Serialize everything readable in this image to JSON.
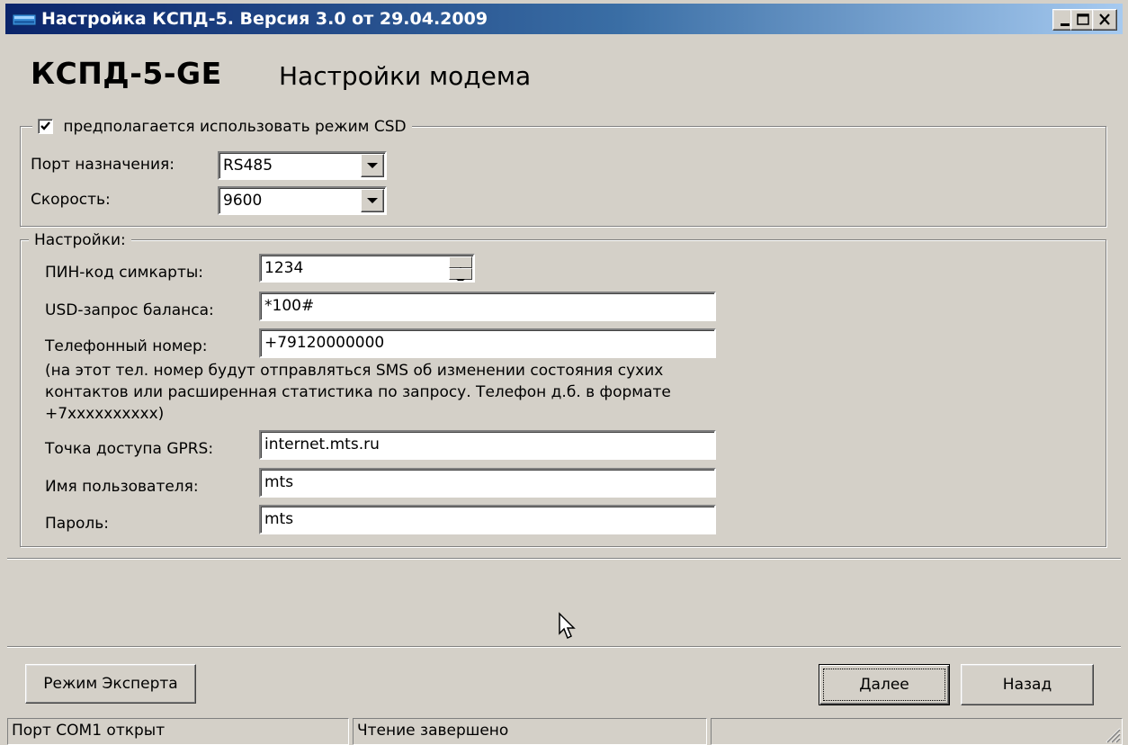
{
  "window": {
    "title": "Настройка КСПД-5. Версия 3.0 от 29.04.2009",
    "controls": {
      "minimize_icon": "minimize-icon",
      "maximize_icon": "maximize-icon",
      "close_icon": "close-icon"
    }
  },
  "header": {
    "brand": "КСПД-5-GE",
    "subtitle": "Настройки модема"
  },
  "csd_group": {
    "checkbox_label": "предполагается использовать режим CSD",
    "checked": true,
    "port_label": "Порт назначения:",
    "port_value": "RS485",
    "speed_label": "Скорость:",
    "speed_value": "9600"
  },
  "settings_group": {
    "legend": "Настройки:",
    "pin_label": "ПИН-код симкарты:",
    "pin_value": "1234",
    "usd_label": "USD-запрос баланса:",
    "usd_value": "*100#",
    "phone_label": "Телефонный номер:",
    "phone_value": "+79120000000",
    "phone_note": "(на этот тел. номер будут отправляться SMS об изменении состояния сухих контактов или расширенная статистика по запросу. Телефон д.б. в формате +7xxxxxxxxxx)",
    "apn_label": "Точка доступа GPRS:",
    "apn_value": "internet.mts.ru",
    "user_label": "Имя пользователя:",
    "user_value": "mts",
    "password_label": "Пароль:",
    "password_value": "mts"
  },
  "buttons": {
    "expert": "Режим Эксперта",
    "next": "Далее",
    "back": "Назад"
  },
  "statusbar": {
    "port": "Порт COM1 открыт",
    "read": "Чтение завершено",
    "extra": ""
  },
  "colors": {
    "face": "#d4d0c8",
    "title_start": "#0a246a",
    "title_end": "#a6caf0"
  }
}
